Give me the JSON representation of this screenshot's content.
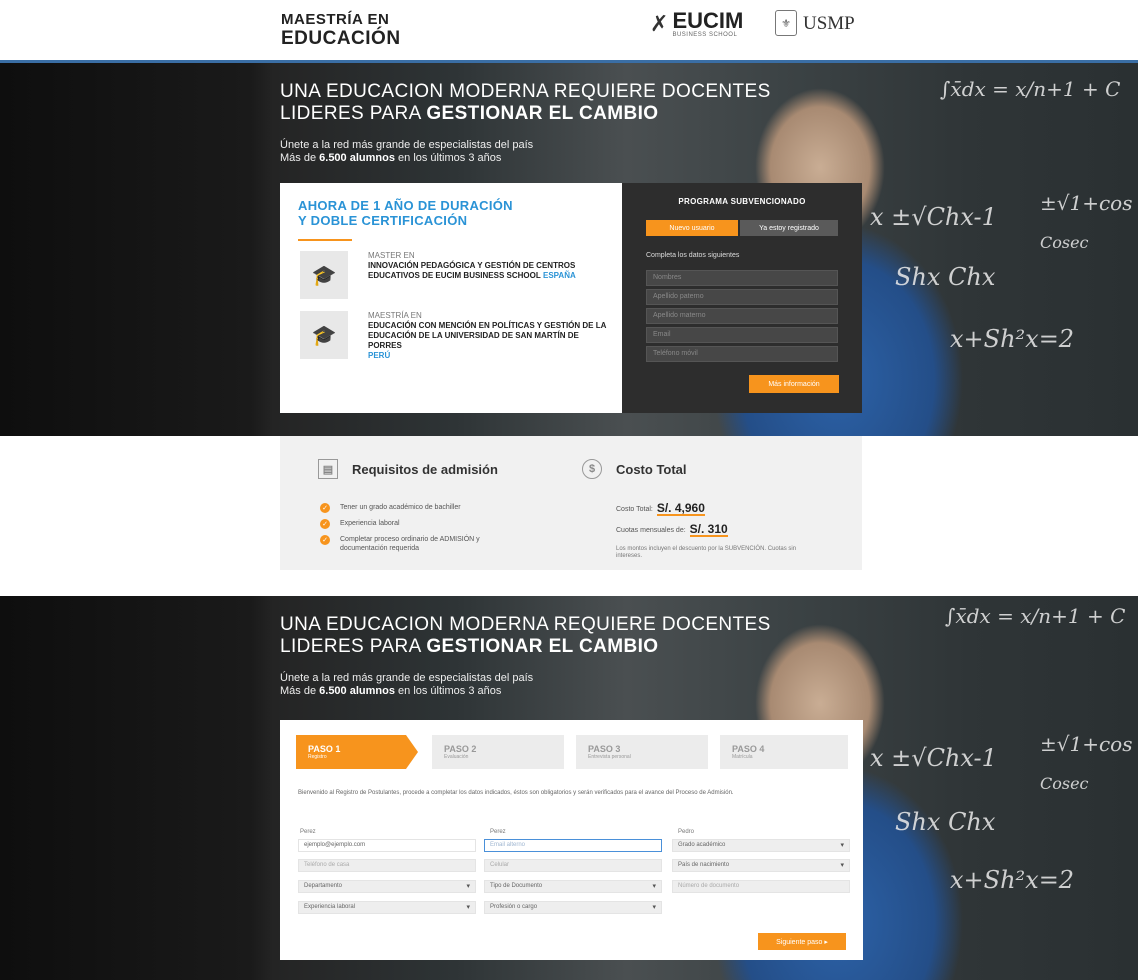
{
  "header": {
    "brand_line1": "MAESTRÍA EN",
    "brand_line2": "EDUCACIÓN",
    "eucim_logo": "EUCIM",
    "eucim_sub": "BUSINESS SCHOOL",
    "usmp_logo": "USMP"
  },
  "hero": {
    "title_line1": "UNA EDUCACION MODERNA REQUIERE DOCENTES",
    "title_line2_pre": "LIDERES PARA ",
    "title_line2_bold": "GESTIONAR EL CAMBIO",
    "sub_line1": "Únete a la red más grande de especialistas del país",
    "sub_line2_pre": "Más de ",
    "sub_line2_bold": "6.500 alumnos",
    "sub_line2_post": " en los últimos 3 años"
  },
  "chalkboard": {
    "f1": "∫x̄dx = x/n+1 + C",
    "f2": "x ±√Chx-1",
    "f3": "±√1+cos",
    "f4": "Cosec",
    "f5": "Shx Chx",
    "f6": "x+Sh²x=2"
  },
  "duration_card": {
    "title_line1": "AHORA DE 1 AÑO DE DURACIÓN",
    "title_line2": "Y DOBLE CERTIFICACIÓN",
    "programs": [
      {
        "icon": "graduation-cap-icon",
        "label": "MASTER EN",
        "name": "INNOVACIÓN PEDAGÓGICA Y GESTIÓN DE CENTROS EDUCATIVOS DE EUCIM BUSINESS SCHOOL",
        "country": "ESPAÑA"
      },
      {
        "icon": "graduation-cap-icon",
        "label": "MAESTRÍA EN",
        "name": "EDUCACIÓN CON MENCIÓN EN POLÍTICAS Y GESTIÓN DE LA EDUCACIÓN DE LA UNIVERSIDAD DE SAN MARTÍN DE PORRES",
        "country": "PERÚ"
      }
    ]
  },
  "form1": {
    "title": "PROGRAMA SUBVENCIONADO",
    "tab_new": "Nuevo usuario",
    "tab_registered": "Ya estoy registrado",
    "lead": "Completa los datos siguientes",
    "fields": [
      "Nombres",
      "Apellido paterno",
      "Apellido materno",
      "Email",
      "Teléfono móvil"
    ],
    "submit": "Más información"
  },
  "requirements": {
    "title": "Requisitos de admisión",
    "items": [
      "Tener un grado académico de bachiller",
      "Experiencia laboral",
      "Completar proceso ordinario de ADMISIÓN y documentación requerida"
    ]
  },
  "cost": {
    "title": "Costo Total",
    "total_label": "Costo Total:",
    "total_value": "S/. 4,960",
    "monthly_label": "Cuotas mensuales de:",
    "monthly_value": "S/. 310",
    "note": "Los montos incluyen el descuento por la SUBVENCIÓN. Cuotas sin intereses."
  },
  "steps": [
    {
      "label": "PASO 1",
      "sub": "Registro"
    },
    {
      "label": "PASO 2",
      "sub": "Evaluación"
    },
    {
      "label": "PASO 3",
      "sub": "Entrevista personal"
    },
    {
      "label": "PASO 4",
      "sub": "Matrícula"
    }
  ],
  "form2": {
    "intro": "Bienvenido al Registro de Postulantes, procede a completar los datos indicados, éstos son obligatorios y serán verificados para el avance del Proceso de Admisión.",
    "col1": {
      "label": "Perez",
      "email": "ejemplo@ejemplo.com",
      "phone_placeholder": "Teléfono de casa",
      "department": "Departamento",
      "experience": "Experiencia laboral"
    },
    "col2": {
      "label": "Perez",
      "email_placeholder": "Email alterno",
      "mobile_placeholder": "Celular",
      "doc_type": "Tipo de Documento",
      "position": "Profesión o cargo"
    },
    "col3": {
      "label": "Pedro",
      "degree": "Grado académico",
      "birth_country": "País de nacimiento",
      "doc_number_placeholder": "Número de documento"
    },
    "next": "Siguiente paso ▸"
  },
  "colors": {
    "accent": "#f7941d",
    "link": "#2a93d6",
    "dark_panel": "#2d2d2d"
  }
}
